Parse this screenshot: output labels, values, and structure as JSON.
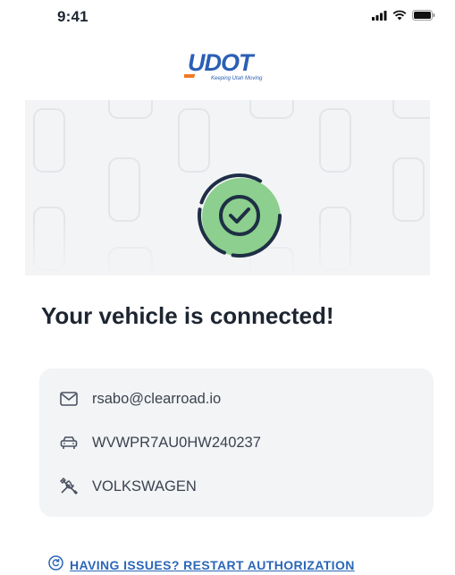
{
  "status_bar": {
    "time": "9:41"
  },
  "brand": {
    "logo_text": "UDOT",
    "tagline": "Keeping Utah Moving",
    "logo_color": "#2b5fb4",
    "accent_color": "#f07a22"
  },
  "hero": {
    "status_icon": "checkmark-circle-icon",
    "success_color": "#8ccf8e"
  },
  "headline": "Your vehicle is connected!",
  "vehicle_info": {
    "email_icon": "envelope-icon",
    "email": "rsabo@clearroad.io",
    "vin_icon": "car-icon",
    "vin": "WVWPR7AU0HW240237",
    "make_icon": "tools-icon",
    "make": "VOLKSWAGEN"
  },
  "restart": {
    "icon": "restart-icon",
    "label": "HAVING ISSUES? RESTART AUTHORIZATION"
  }
}
